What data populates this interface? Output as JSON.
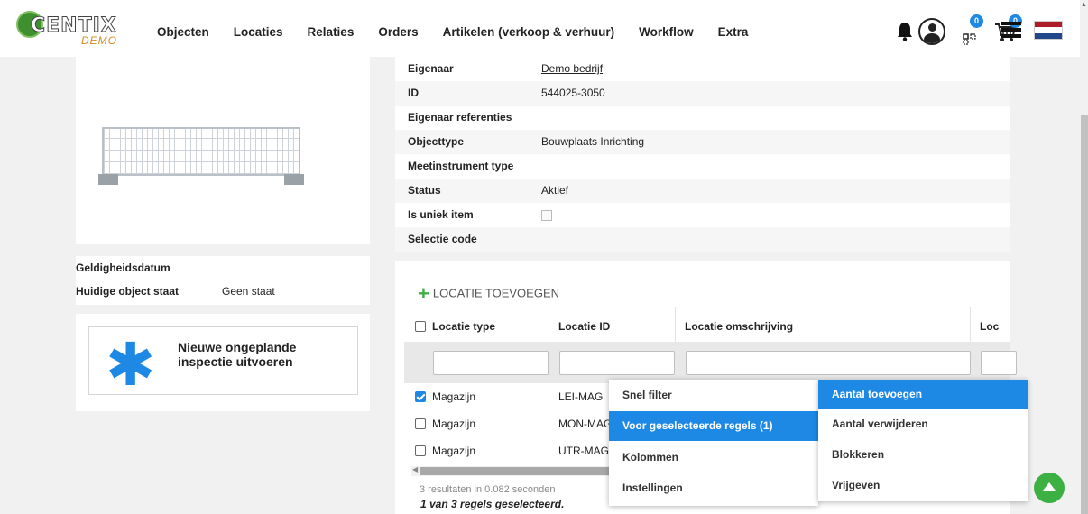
{
  "brand": {
    "logo_text": "CENTIX",
    "logo_sub": "DEMO"
  },
  "nav": [
    "Objecten",
    "Locaties",
    "Relaties",
    "Orders",
    "Artikelen (verkoop & verhuur)",
    "Workflow",
    "Extra"
  ],
  "header_icons": {
    "bell": "bell-icon",
    "avatar": "user-avatar-icon",
    "scan_badge": "0",
    "cart_badge": "0",
    "menu": "hamburger-icon",
    "language": "nl-flag-icon"
  },
  "object_info": {
    "rows": [
      {
        "label": "Geldigheidsdatum",
        "value": ""
      },
      {
        "label": "Huidige object staat",
        "value": "Geen staat"
      }
    ]
  },
  "inspection_card": {
    "icon": "asterisk-icon",
    "text": "Nieuwe ongeplande inspectie uitvoeren"
  },
  "details": [
    {
      "label": "Eigenaar",
      "value": "Demo bedrijf"
    },
    {
      "label": "ID",
      "value": "544025-3050"
    },
    {
      "label": "Eigenaar referenties",
      "value": ""
    },
    {
      "label": "Objecttype",
      "value": "Bouwplaats Inrichting"
    },
    {
      "label": "Meetinstrument type",
      "value": ""
    },
    {
      "label": "Status",
      "value": "Aktief"
    },
    {
      "label": "Is uniek item",
      "value": ""
    },
    {
      "label": "Selectie code",
      "value": ""
    }
  ],
  "locations": {
    "add_label": "LOCATIE TOEVOEGEN",
    "columns": [
      "Locatie type",
      "Locatie ID",
      "Locatie omschrijving",
      "Loc"
    ],
    "rows": [
      {
        "type": "Magazijn",
        "id": "LEI-MAG",
        "checked": true
      },
      {
        "type": "Magazijn",
        "id": "MON-MAG",
        "checked": false
      },
      {
        "type": "Magazijn",
        "id": "UTR-MAG",
        "checked": false
      }
    ],
    "results_text": "3 resultaten in 0.082 seconden",
    "selected_text": "1 van 3 regels geselecteerd."
  },
  "context_menu": {
    "items": [
      "Snel filter",
      "Voor geselecteerde regels (1)",
      "Kolommen",
      "Instellingen"
    ],
    "highlighted": 1
  },
  "submenu": {
    "items": [
      "Aantal toevoegen",
      "Aantal verwijderen",
      "Blokkeren",
      "Vrijgeven"
    ],
    "highlighted": 0
  },
  "colors": {
    "accent": "#1e88e5",
    "green": "#3cb043"
  }
}
